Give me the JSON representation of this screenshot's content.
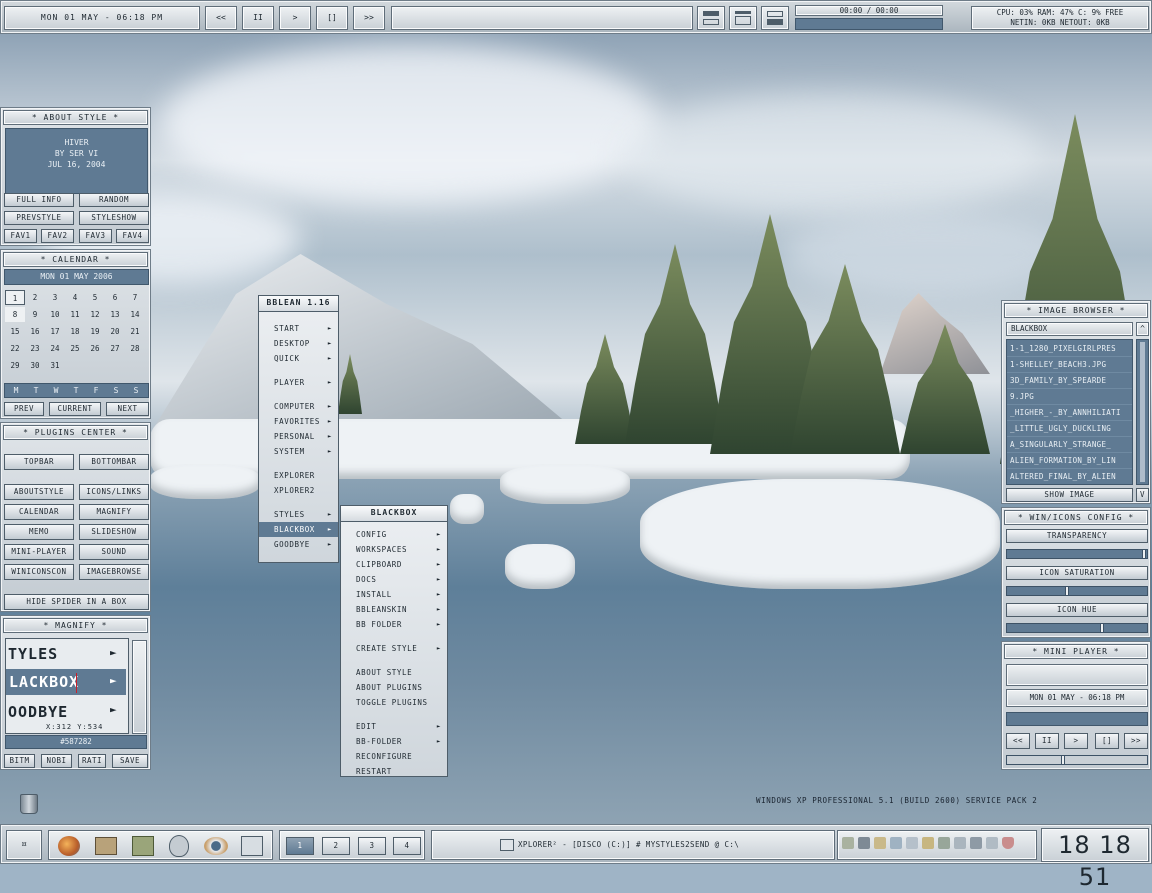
{
  "topbar": {
    "clock": "MON 01 MAY - 06:18 PM",
    "media_buttons": [
      "<<",
      "II",
      ">",
      "[]",
      ">>"
    ],
    "track_display": "",
    "time_progress": "00:00 / 00:00",
    "sys_line1": "CPU: 03% RAM: 47% C: 9% FREE",
    "sys_line2": "NETIN: 0KB    NETOUT: 0KB"
  },
  "about_style": {
    "title": "* ABOUT STYLE *",
    "style_name": "HIVER",
    "author": "BY SER VI",
    "date": "JUL 16, 2004",
    "buttons": [
      "FULL INFO",
      "RANDOM",
      "PREVSTYLE",
      "STYLESHOW",
      "FAV1",
      "FAV2",
      "FAV3",
      "FAV4"
    ]
  },
  "calendar": {
    "title": "* CALENDAR *",
    "header": "MON 01 MAY  2006",
    "days": [
      "1",
      "2",
      "3",
      "4",
      "5",
      "6",
      "7",
      "8",
      "9",
      "10",
      "11",
      "12",
      "13",
      "14",
      "15",
      "16",
      "17",
      "18",
      "19",
      "20",
      "21",
      "22",
      "23",
      "24",
      "25",
      "26",
      "27",
      "28",
      "29",
      "30",
      "31"
    ],
    "weekdays": [
      "M",
      "T",
      "W",
      "T",
      "F",
      "S",
      "S"
    ],
    "prev": "PREV",
    "current": "CURRENT",
    "next": "NEXT"
  },
  "plugins_center": {
    "title": "* PLUGINS CENTER *",
    "buttons": [
      "TOPBAR",
      "BOTTOMBAR",
      "ABOUTSTYLE",
      "ICONS/LINKS",
      "CALENDAR",
      "MAGNIFY",
      "MEMO",
      "SLIDESHOW",
      "MINI-PLAYER",
      "SOUND",
      "WINICONSCON",
      "IMAGEBROWSE"
    ],
    "hide": "HIDE SPIDER IN A BOX"
  },
  "magnify": {
    "title": "* MAGNIFY *",
    "line1": "TYLES",
    "line2": "LACKBOX",
    "line3": "OODBYE",
    "coords": "X:312  Y:534",
    "color": "#587282",
    "buttons": [
      "BITM",
      "NOBI",
      "RATI",
      "SAVE"
    ]
  },
  "bblean_menu": {
    "title": "BBLEAN 1.16",
    "items": [
      "START",
      "DESKTOP",
      "QUICK",
      "PLAYER",
      "COMPUTER",
      "FAVORITES",
      "PERSONAL",
      "SYSTEM",
      "EXPLORER",
      "XPLORER2",
      "STYLES",
      "BLACKBOX",
      "GOODBYE"
    ]
  },
  "blackbox_menu": {
    "title": "BLACKBOX",
    "items": [
      "CONFIG",
      "WORKSPACES",
      "CLIPBOARD",
      "DOCS",
      "INSTALL",
      "BBLEANSKIN",
      "BB FOLDER",
      "CREATE STYLE",
      "ABOUT STYLE",
      "ABOUT PLUGINS",
      "TOGGLE PLUGINS",
      "EDIT",
      "BB-FOLDER",
      "RECONFIGURE",
      "RESTART"
    ]
  },
  "image_browser": {
    "title": "* IMAGE BROWSER *",
    "folder": "BLACKBOX",
    "files": [
      "1-1_1280_PIXELGIRLPRES",
      "1-SHELLEY_BEACH3.JPG",
      "3D_FAMILY_BY_SPEARDE",
      "9.JPG",
      "_HIGHER_-_BY_ANNHILIATI",
      "_LITTLE_UGLY_DUCKLING",
      "A_SINGULARLY_STRANGE_",
      "ALIEN_FORMATION_BY_LIN",
      "ALTERED_FINAL_BY_ALIEN"
    ],
    "show": "SHOW IMAGE",
    "scroll_up": "^",
    "scroll_down": "V"
  },
  "win_icons": {
    "title": "* WIN/ICONS CONFIG *",
    "labels": [
      "TRANSPARENCY",
      "ICON SATURATION",
      "ICON HUE"
    ],
    "values": [
      1.0,
      0.45,
      0.7
    ]
  },
  "mini_player": {
    "title": "* MINI PLAYER *",
    "clock": "MON 01 MAY - 06:18 PM",
    "buttons": [
      "<<",
      "II",
      ">",
      "[]",
      ">>"
    ],
    "volume": 0.4
  },
  "desktop": {
    "os_info": "WINDOWS XP PROFESSIONAL 5.1 (BUILD 2600) SERVICE PACK 2"
  },
  "taskbar": {
    "workspaces": [
      "1",
      "2",
      "3",
      "4"
    ],
    "task": "XPLORER² - [DISCO (C:)] # MYSTYLES2SEND @ C:\\",
    "clock": "18 18 51"
  }
}
